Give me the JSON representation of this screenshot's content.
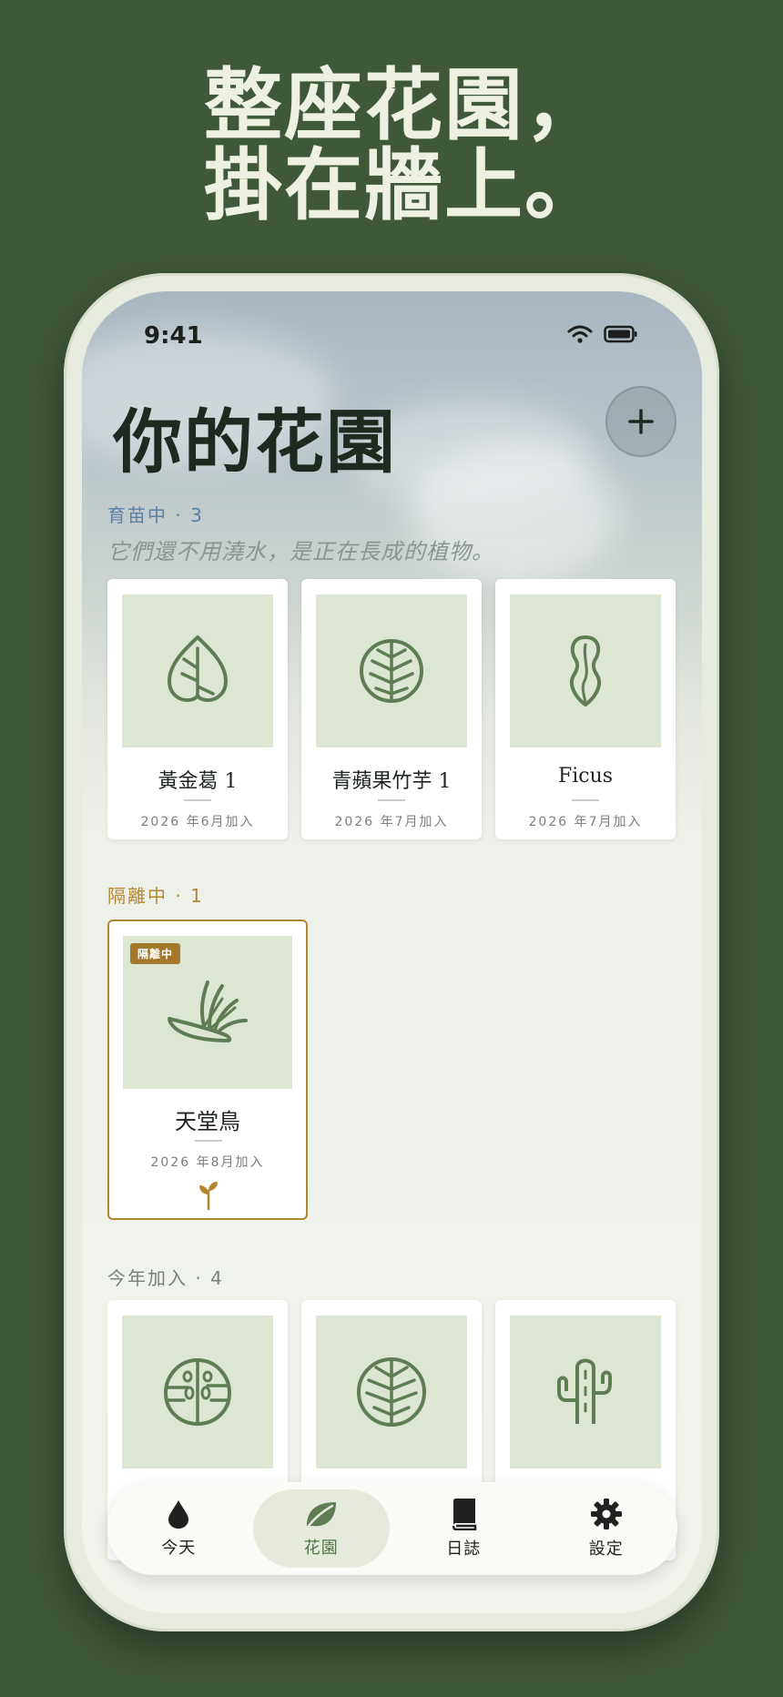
{
  "headline": {
    "line1": "整座花園，",
    "line2": "掛在牆上。"
  },
  "status_bar": {
    "time": "9:41"
  },
  "header": {
    "title": "你的花園"
  },
  "colors": {
    "background": "#3f5838",
    "accent_green": "#5f7d52",
    "quarantine_gold": "#b3862f",
    "leaf_tile": "#dde5d3"
  },
  "sections": {
    "seedlings": {
      "label": "育苗中 · 3",
      "subtitle": "它們還不用澆水，是正在長成的植物。",
      "cards": [
        {
          "name": "黃金葛 1",
          "date": "2026 年6月加入",
          "icon": "heart-leaf-icon"
        },
        {
          "name": "青蘋果竹芋 1",
          "date": "2026 年7月加入",
          "icon": "round-leaf-icon"
        },
        {
          "name": "Ficus",
          "date": "2026 年7月加入",
          "icon": "violin-leaf-icon"
        }
      ]
    },
    "quarantine": {
      "label": "隔離中 · 1",
      "card": {
        "badge": "隔離中",
        "name": "天堂鳥",
        "date": "2026 年8月加入",
        "icon": "bird-of-paradise-icon"
      }
    },
    "this_year": {
      "label": "今年加入 · 4",
      "cards": [
        {
          "icon": "monstera-leaf-icon"
        },
        {
          "icon": "round-leaf-icon"
        },
        {
          "icon": "cactus-icon"
        }
      ]
    }
  },
  "tabbar": {
    "today": "今天",
    "garden": "花園",
    "journal": "日誌",
    "settings": "設定"
  }
}
